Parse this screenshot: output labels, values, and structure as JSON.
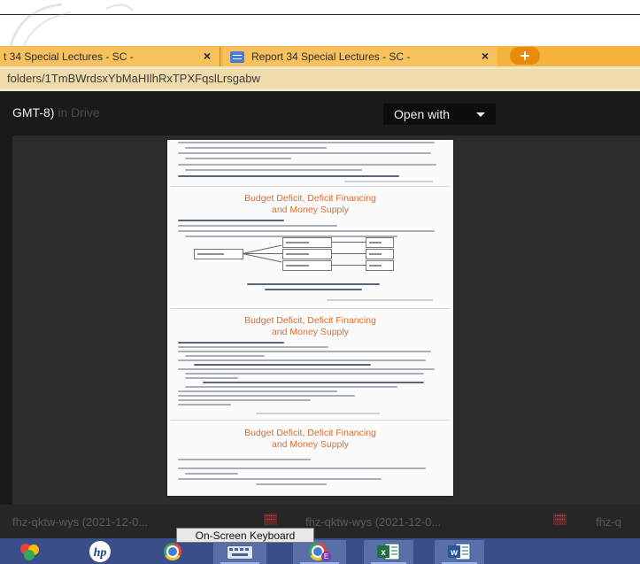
{
  "browser": {
    "tabs": [
      {
        "title": "t 34 Special Lectures - SC -",
        "close": "×"
      },
      {
        "title": "Report 34 Special Lectures - SC -",
        "close": "×"
      }
    ],
    "new_tab_label": "+",
    "url": "folders/1TmBWrdsxYbMaHIlhRxTPXFqslLrsgabw"
  },
  "viewer": {
    "title": "GMT-8)",
    "title_ghost": "in Drive",
    "open_with": "Open with"
  },
  "document": {
    "slide_titles": [
      [
        "Budget Deficit, Deficit Financing",
        "and Money Supply"
      ],
      [
        "Budget Deficit, Deficit Financing",
        "and Money Supply"
      ],
      [
        "Budget Deficit, Deficit Financing",
        "and Money Supply"
      ]
    ]
  },
  "downloads": {
    "items": [
      {
        "label": "fhz-qktw-wys (2021-12-0..."
      },
      {
        "label": "fhz-qktw-wys (2021-12-0..."
      },
      {
        "label": "fhz-q"
      }
    ]
  },
  "taskbar": {
    "tooltip": "On-Screen Keyboard",
    "apps": [
      {
        "icon": "colorful-app-icon"
      },
      {
        "icon": "hp-logo-icon"
      },
      {
        "icon": "chrome-icon"
      },
      {
        "icon": "keyboard-icon"
      },
      {
        "icon": "chrome-profile-icon"
      },
      {
        "icon": "excel-icon"
      },
      {
        "icon": "word-icon"
      }
    ]
  },
  "colors": {
    "tab_strip": "#f4b43d",
    "address_bar": "#efdcaa",
    "viewer_dark": "#2c2c2c",
    "slide_title": "#e06b2b",
    "taskbar": "#3a4f8a"
  }
}
